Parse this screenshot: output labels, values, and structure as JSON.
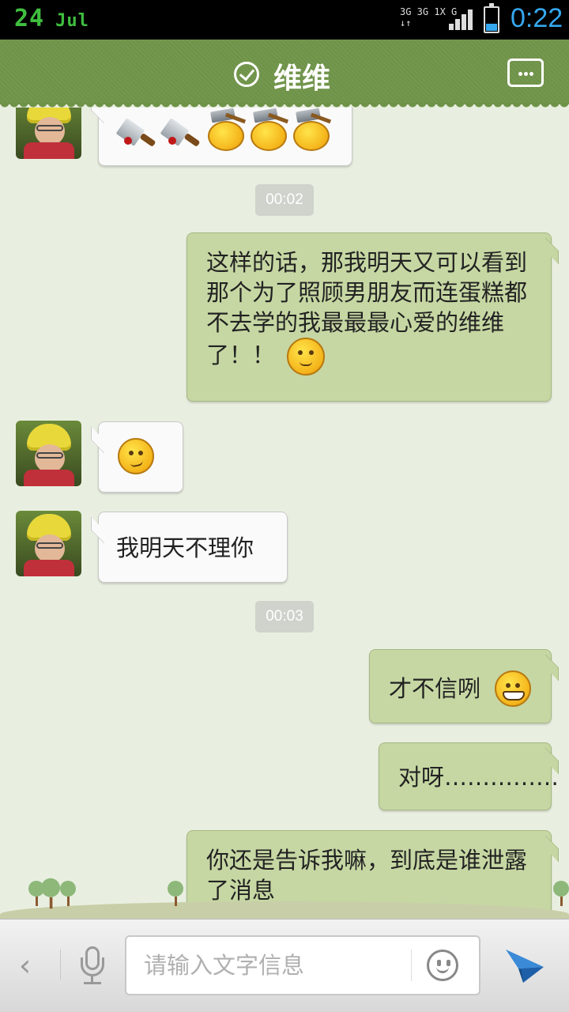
{
  "status_bar": {
    "date_day": "24",
    "date_month": "Jul",
    "network_line1": "3G 3G 1X  G",
    "network_line2": "↓↑ ",
    "time": "0:22",
    "battery_level": 0.3
  },
  "header": {
    "title": "维维",
    "verified_icon": "check-circle-icon",
    "more_icon": "chat-bubble-more-icon"
  },
  "messages": [
    {
      "side": "in",
      "emojis": [
        "cleaver-icon",
        "cleaver-icon",
        "hammer-icon",
        "hammer-icon",
        "hammer-icon"
      ]
    },
    {
      "type": "timestamp",
      "text": "00:02"
    },
    {
      "side": "out",
      "text": "这样的话，那我明天又可以看到那个为了照顾男朋友而连蛋糕都不去学的我最最最心爱的维维了！！",
      "emoji": "kiss-emoji"
    },
    {
      "side": "in",
      "emoji": "confused-emoji"
    },
    {
      "side": "in",
      "text": "我明天不理你"
    },
    {
      "type": "timestamp",
      "text": "00:03"
    },
    {
      "side": "out",
      "text": "才不信咧",
      "emoji": "grin-emoji"
    },
    {
      "side": "out",
      "text": "对呀……………"
    },
    {
      "side": "out",
      "text": "你还是告诉我嘛，到底是谁泄露了消息"
    }
  ],
  "input_bar": {
    "placeholder": "请输入文字信息",
    "back_icon": "chevron-left-icon",
    "mic_icon": "microphone-icon",
    "emoji_icon": "smiley-icon",
    "send_icon": "paper-plane-icon"
  },
  "colors": {
    "header": "#6e9247",
    "outgoing_bubble": "#c6d7a3",
    "incoming_bubble": "#fafafa",
    "background": "#e9efe0",
    "status_time": "#36a8f0"
  }
}
